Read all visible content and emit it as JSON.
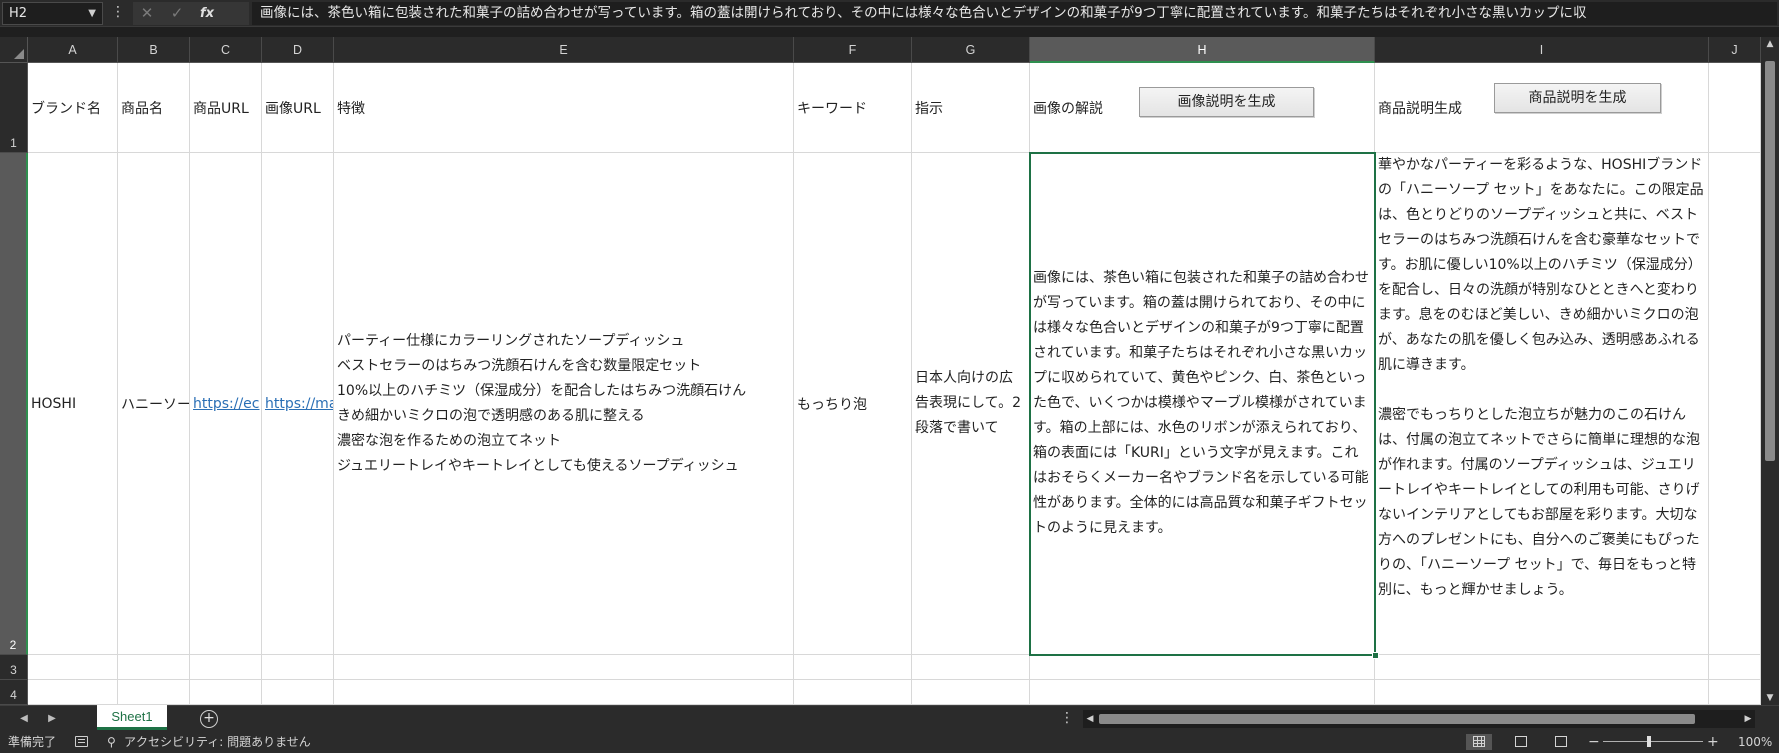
{
  "formula_bar": {
    "name_box": "H2",
    "formula": "画像には、茶色い箱に包装された和菓子の詰め合わせが写っています。箱の蓋は開けられており、その中には様々な色合いとデザインの和菓子が9つ丁寧に配置されています。和菓子たちはそれぞれ小さな黒いカップに収"
  },
  "columns": [
    "A",
    "B",
    "C",
    "D",
    "E",
    "F",
    "G",
    "H",
    "I",
    "J"
  ],
  "rows": [
    "1",
    "2",
    "3",
    "4"
  ],
  "headers": {
    "A": "ブランド名",
    "B": "商品名",
    "C": "商品URL",
    "D": "画像URL",
    "E": "特徴",
    "F": "キーワード",
    "G": "指示",
    "H": "画像の解説",
    "I": "商品説明生成"
  },
  "buttons": {
    "generate_image_description": "画像説明を生成",
    "generate_product_description": "商品説明を生成"
  },
  "row2": {
    "brand": "HOSHI",
    "product": "ハニーソー",
    "product_url": "https://ec",
    "image_url": "https://ma",
    "features": "パーティー仕様にカラーリングされたソープディッシュ\nベストセラーのはちみつ洗顔石けんを含む数量限定セット\n10%以上のハチミツ（保湿成分）を配合したはちみつ洗顔石けん\nきめ細かいミクロの泡で透明感のある肌に整える\n濃密な泡を作るための泡立てネット\nジュエリートレイやキートレイとしても使えるソープディッシュ",
    "keyword": "もっちり泡",
    "instruction": "日本人向けの広告表現にして。2段落で書いて",
    "image_description": "画像には、茶色い箱に包装された和菓子の詰め合わせが写っています。箱の蓋は開けられており、その中には様々な色合いとデザインの和菓子が9つ丁寧に配置されています。和菓子たちはそれぞれ小さな黒いカップに収められていて、黄色やピンク、白、茶色といった色で、いくつかは模様やマーブル模様がされています。箱の上部には、水色のリボンが添えられており、箱の表面には「KURI」という文字が見えます。これはおそらくメーカー名やブランド名を示している可能性があります。全体的には高品質な和菓子ギフトセットのように見えます。",
    "product_description": "華やかなパーティーを彩るような、HOSHIブランドの「ハニーソープ セット」をあなたに。この限定品は、色とりどりのソープディッシュと共に、ベストセラーのはちみつ洗顔石けんを含む豪華なセットです。お肌に優しい10%以上のハチミツ（保湿成分）を配合し、日々の洗顔が特別なひとときへと変わります。息をのむほど美しい、きめ細かいミクロの泡が、あなたの肌を優しく包み込み、透明感あふれる肌に導きます。\n\n濃密でもっちりとした泡立ちが魅力のこの石けんは、付属の泡立てネットでさらに簡単に理想的な泡が作れます。付属のソープディッシュは、ジュエリートレイやキートレイとしての利用も可能、さりげないインテリアとしてもお部屋を彩ります。大切な方へのプレゼントにも、自分へのご褒美にもぴったりの、「ハニーソープ セット」で、毎日をもっと特別に、もっと輝かせましょう。"
  },
  "sheet_tab": "Sheet1",
  "status": {
    "ready": "準備完了",
    "accessibility": "アクセシビリティ: 問題ありません",
    "zoom": "100%"
  },
  "colors": {
    "accent": "#1e7145",
    "link": "#2a6fb5",
    "chrome": "#2b2b2b"
  }
}
